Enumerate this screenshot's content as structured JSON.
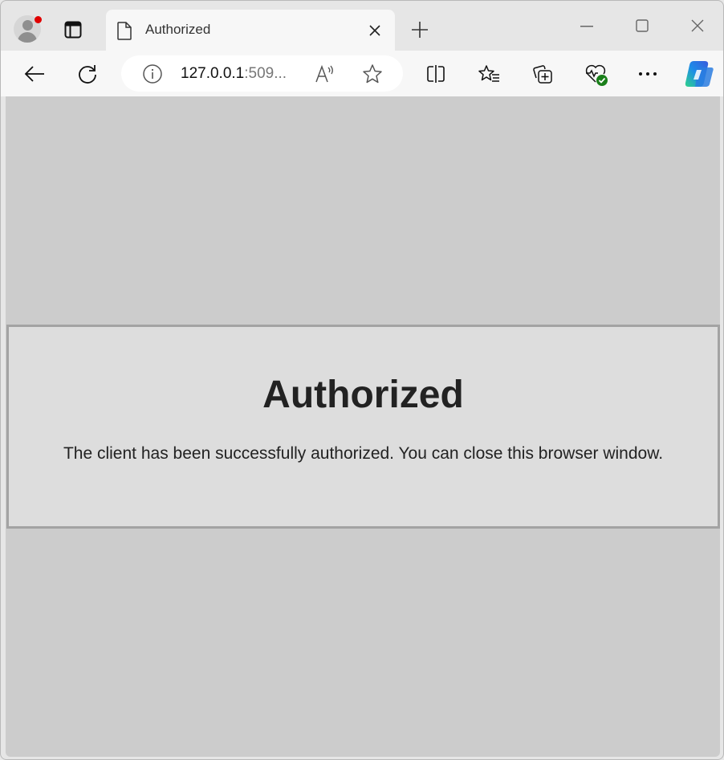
{
  "browser": {
    "tab": {
      "title": "Authorized",
      "icon": "document-icon"
    },
    "address": {
      "host": "127.0.0.1",
      "port_truncated": ":509..."
    },
    "colors": {
      "page_bg": "#cccccc",
      "card_bg": "#dddddd",
      "card_border": "#a3a3a3",
      "notification_dot": "#e00000",
      "health_check": "#1a7f1a"
    }
  },
  "page": {
    "heading": "Authorized",
    "message": "The client has been successfully authorized. You can close this browser window."
  }
}
